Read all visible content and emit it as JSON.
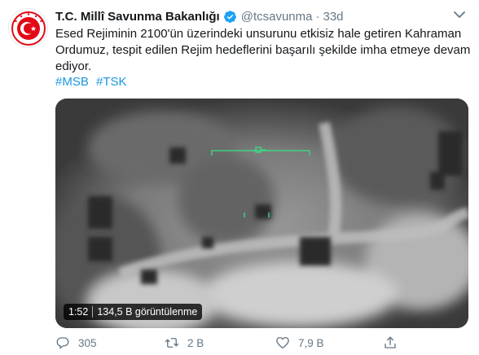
{
  "account": {
    "name": "T.C. Millî Savunma Bakanlığı",
    "handle": "@tcsavunma",
    "separator": "·",
    "time": "33d"
  },
  "tweet": {
    "text": "Esed Rejiminin 2100'ün üzerindeki unsurunu etkisiz hale getiren Kahraman Ordumuz, tespit edilen Rejim hedeflerini başarılı şekilde imha etmeye devam ediyor.",
    "hashtags": [
      "#MSB",
      "#TSK"
    ]
  },
  "video": {
    "duration": "1:52",
    "views": "134,5 B görüntülenme"
  },
  "actions": {
    "replies": "305",
    "retweets": "2 B",
    "likes": "7,9 B"
  },
  "colors": {
    "link": "#1b95e0",
    "secondary_text": "#657786",
    "logo_red": "#e30a17"
  },
  "icons": [
    "verified-badge-icon",
    "chevron-down-icon",
    "reply-icon",
    "retweet-icon",
    "like-icon",
    "share-icon"
  ]
}
